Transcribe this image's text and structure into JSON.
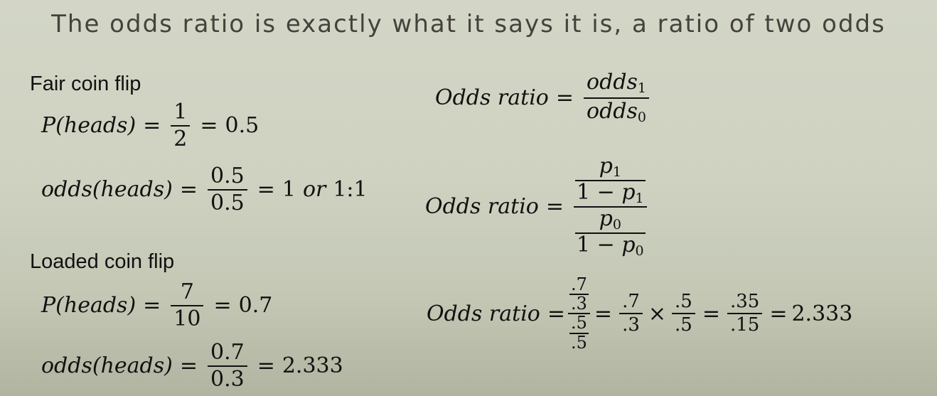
{
  "title": "The odds ratio is exactly what it says it is, a ratio of two odds",
  "fair": {
    "heading": "Fair coin flip",
    "p_lhs": "P(heads)",
    "p_num": "1",
    "p_den": "2",
    "p_result": "0.5",
    "odds_lhs": "odds(heads)",
    "odds_num": "0.5",
    "odds_den": "0.5",
    "odds_result_a": "1",
    "odds_result_or": "or",
    "odds_result_b": "1:1"
  },
  "loaded": {
    "heading": "Loaded coin flip",
    "p_lhs": "P(heads)",
    "p_num": "7",
    "p_den": "10",
    "p_result": "0.7",
    "odds_lhs": "odds(heads)",
    "odds_num": "0.7",
    "odds_den": "0.3",
    "odds_result": "2.333"
  },
  "or_def": {
    "lhs": "Odds ratio",
    "num_base": "odds",
    "num_sub": "1",
    "den_base": "odds",
    "den_sub": "0"
  },
  "or_prob": {
    "lhs": "Odds ratio",
    "p": "p",
    "sub1": "1",
    "sub0": "0",
    "one_minus": "1 −"
  },
  "or_calc": {
    "lhs": "Odds ratio",
    "n1": ".7",
    "d1": ".3",
    "n2": ".5",
    "d2": ".5",
    "f1_num": ".7",
    "f1_den": ".3",
    "times": "×",
    "f2_num": ".5",
    "f2_den": ".5",
    "f3_num": ".35",
    "f3_den": ".15",
    "result": "2.333"
  }
}
